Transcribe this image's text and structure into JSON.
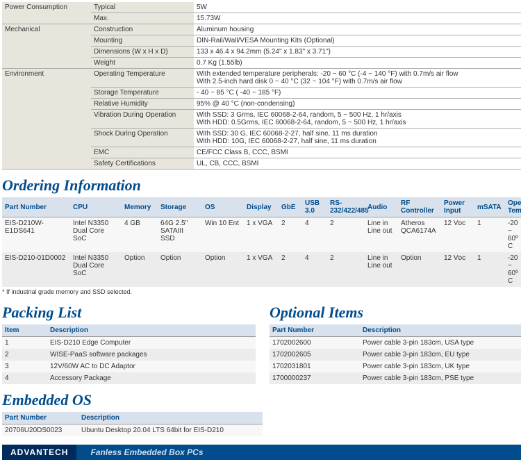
{
  "spec": {
    "power": {
      "cat": "Power Consumption",
      "rows": [
        [
          "Typical",
          "5W"
        ],
        [
          "Max.",
          "15.73W"
        ]
      ]
    },
    "mech": {
      "cat": "Mechanical",
      "rows": [
        [
          "Construction",
          "Aluminum housing"
        ],
        [
          "Mounting",
          "DIN-Rail/Wall/VESA Mounting Kits (Optional)"
        ],
        [
          "Dimensions (W x H x D)",
          "133 x 46.4 x 94.2mm (5.24\" x 1.83\" x 3.71\")"
        ],
        [
          "Weight",
          "0.7 Kg (1.55lb)"
        ]
      ]
    },
    "env": {
      "cat": "Environment",
      "rows": [
        [
          "Operating Temperature",
          "With extended temperature peripherals: -20 ~ 60 °C (-4 ~ 140 °F) with 0.7m/s air flow\nWith 2.5-inch hard disk 0 ~ 40 °C (32 ~ 104 °F) with 0.7m/s air flow"
        ],
        [
          "Storage  Temperature",
          "- 40 ~ 85 °C ( -40 ~ 185 °F)"
        ],
        [
          "Relative Humidity",
          "95% @ 40 °C (non-condensing)"
        ],
        [
          "Vibration During Operation",
          "With SSD: 3 Grms, IEC 60068-2-64, random, 5 ~ 500 Hz, 1 hr/axis\nWith HDD: 0.5Grms, IEC 60068-2-64, random, 5 ~ 500 Hz, 1 hr/axis"
        ],
        [
          "Shock During Operation",
          "With SSD: 30 G, IEC 60068-2-27, half sine, 11 ms duration\nWith HDD: 10G, IEC 60068-2-27, half sine, 11 ms duration"
        ],
        [
          "EMC",
          "CE/FCC Class B, CCC, BSMI"
        ],
        [
          "Safety Certifications",
          "UL, CB, CCC, BSMI"
        ]
      ]
    }
  },
  "ordering": {
    "title": "Ordering Information",
    "headers": [
      "Part Number",
      "CPU",
      "Memory",
      "Storage",
      "OS",
      "Display",
      "GbE",
      "USB 3.0",
      "RS-232/422/485",
      "Audio",
      "RF Controller",
      "Power Input",
      "mSATA",
      "Operating Temperature*"
    ],
    "rows": [
      [
        "EIS-D210W-E1DS641",
        "Intel N3350 Dual Core SoC",
        "4 GB",
        "64G 2.5\" SATAIII SSD",
        "Win 10 Ent",
        "1 x VGA",
        "2",
        "4",
        "2",
        "Line in\nLine out",
        "Atheros QCA6174A",
        "12 Vᴅᴄ",
        "1",
        "-20 ~ 60º C"
      ],
      [
        "EIS-D210-01D0002",
        "Intel N3350 Dual Core SoC",
        "Option",
        "Option",
        "Option",
        "1 x VGA",
        "2",
        "4",
        "2",
        "Line in\nLine out",
        "Option",
        "12 Vᴅᴄ",
        "1",
        "-20 ~ 60º C"
      ]
    ],
    "note": "* If industrial grade memory and SSD selected."
  },
  "packing": {
    "title": "Packing List",
    "headers": [
      "Item",
      "Description"
    ],
    "rows": [
      [
        "1",
        "EIS-D210 Edge Computer"
      ],
      [
        "2",
        "WISE-PaaS software packages"
      ],
      [
        "3",
        "12V/60W AC to DC Adaptor"
      ],
      [
        "4",
        "Accessory Package"
      ]
    ]
  },
  "optional": {
    "title": "Optional Items",
    "headers": [
      "Part Number",
      "Description"
    ],
    "rows": [
      [
        "1702002600",
        "Power cable 3-pin 183cm, USA type"
      ],
      [
        "1702002605",
        "Power cable 3-pin 183cm, EU type"
      ],
      [
        "1702031801",
        "Power cable 3-pin 183cm, UK type"
      ],
      [
        "1700000237",
        "Power cable 3-pin 183cm, PSE type"
      ]
    ]
  },
  "embedded": {
    "title": "Embedded OS",
    "headers": [
      "Part Number",
      "Description"
    ],
    "rows": [
      [
        "20706U20DS0023",
        "Ubuntu Desktop 20.04 LTS 64bit for EIS-D210"
      ]
    ]
  },
  "footer": {
    "logo": "ADVANTECH",
    "text": "Fanless Embedded Box PCs"
  }
}
